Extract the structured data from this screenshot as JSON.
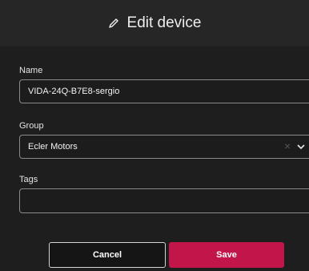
{
  "dialog": {
    "title": "Edit device",
    "icon": "pencil-icon"
  },
  "form": {
    "name": {
      "label": "Name",
      "value": "VIDA-24Q-B7E8-sergio"
    },
    "group": {
      "label": "Group",
      "value": "Ecler Motors"
    },
    "tags": {
      "label": "Tags",
      "value": ""
    }
  },
  "buttons": {
    "cancel": "Cancel",
    "save": "Save"
  },
  "colors": {
    "background": "#1e1e1e",
    "save_button": "#c2164a"
  }
}
